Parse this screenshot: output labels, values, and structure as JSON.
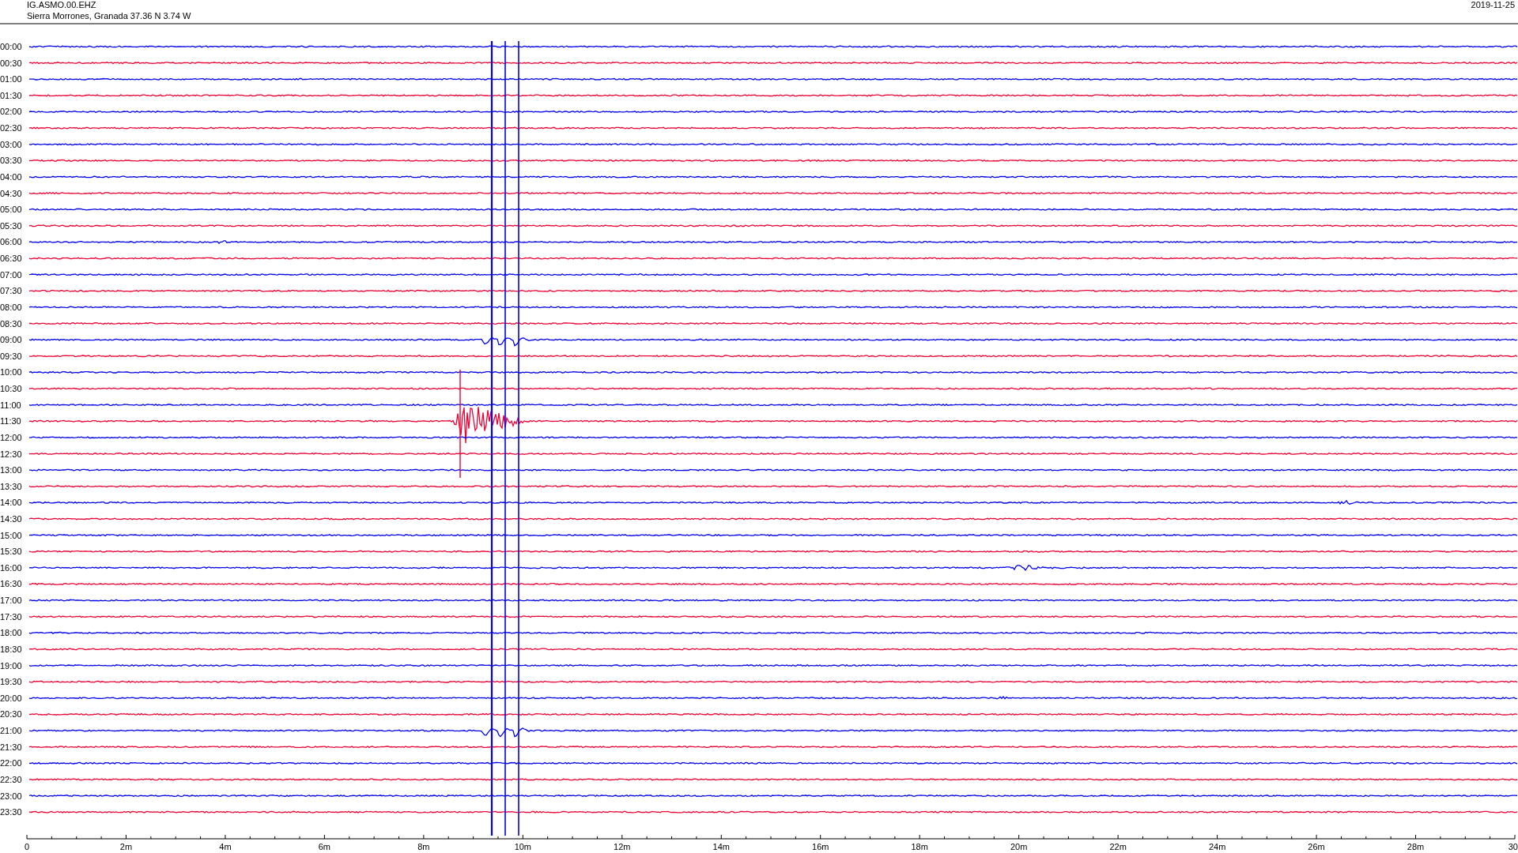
{
  "header": {
    "station": "IG.ASMO.00.EHZ",
    "location": "Sierra Morrones, Granada  37.36 N 3.74 W",
    "date": "2019-11-25"
  },
  "traces": [
    {
      "label": "00:00",
      "color": "#0000ee"
    },
    {
      "label": "00:30",
      "color": "#ee0033"
    },
    {
      "label": "01:00",
      "color": "#0000ee"
    },
    {
      "label": "01:30",
      "color": "#ee0033"
    },
    {
      "label": "02:00",
      "color": "#0000ee"
    },
    {
      "label": "02:30",
      "color": "#ee0033"
    },
    {
      "label": "03:00",
      "color": "#0000ee"
    },
    {
      "label": "03:30",
      "color": "#ee0033"
    },
    {
      "label": "04:00",
      "color": "#0000ee"
    },
    {
      "label": "04:30",
      "color": "#ee0033"
    },
    {
      "label": "05:00",
      "color": "#0000ee"
    },
    {
      "label": "05:30",
      "color": "#ee0033"
    },
    {
      "label": "06:00",
      "color": "#0000ee"
    },
    {
      "label": "06:30",
      "color": "#ee0033"
    },
    {
      "label": "07:00",
      "color": "#0000ee"
    },
    {
      "label": "07:30",
      "color": "#ee0033"
    },
    {
      "label": "08:00",
      "color": "#0000ee"
    },
    {
      "label": "08:30",
      "color": "#ee0033"
    },
    {
      "label": "09:00",
      "color": "#0000ee"
    },
    {
      "label": "09:30",
      "color": "#ee0033"
    },
    {
      "label": "10:00",
      "color": "#0000ee"
    },
    {
      "label": "10:30",
      "color": "#ee0033"
    },
    {
      "label": "11:00",
      "color": "#0000ee"
    },
    {
      "label": "11:30",
      "color": "#ee0033"
    },
    {
      "label": "12:00",
      "color": "#0000ee"
    },
    {
      "label": "12:30",
      "color": "#ee0033"
    },
    {
      "label": "13:00",
      "color": "#0000ee"
    },
    {
      "label": "13:30",
      "color": "#ee0033"
    },
    {
      "label": "14:00",
      "color": "#0000ee"
    },
    {
      "label": "14:30",
      "color": "#ee0033"
    },
    {
      "label": "15:00",
      "color": "#0000ee"
    },
    {
      "label": "15:30",
      "color": "#ee0033"
    },
    {
      "label": "16:00",
      "color": "#0000ee"
    },
    {
      "label": "16:30",
      "color": "#ee0033"
    },
    {
      "label": "17:00",
      "color": "#0000ee"
    },
    {
      "label": "17:30",
      "color": "#ee0033"
    },
    {
      "label": "18:00",
      "color": "#0000ee"
    },
    {
      "label": "18:30",
      "color": "#ee0033"
    },
    {
      "label": "19:00",
      "color": "#0000ee"
    },
    {
      "label": "19:30",
      "color": "#ee0033"
    },
    {
      "label": "20:00",
      "color": "#0000ee"
    },
    {
      "label": "20:30",
      "color": "#ee0033"
    },
    {
      "label": "21:00",
      "color": "#0000ee"
    },
    {
      "label": "21:30",
      "color": "#ee0033"
    },
    {
      "label": "22:00",
      "color": "#0000ee"
    },
    {
      "label": "22:30",
      "color": "#ee0033"
    },
    {
      "label": "23:00",
      "color": "#0000ee"
    },
    {
      "label": "23:30",
      "color": "#ee0033"
    }
  ],
  "x_axis": {
    "labels": [
      "0",
      "2m",
      "4m",
      "6m",
      "8m",
      "10m",
      "12m",
      "14m",
      "16m",
      "18m",
      "20m",
      "22m",
      "24m",
      "26m",
      "28m",
      "30"
    ]
  }
}
